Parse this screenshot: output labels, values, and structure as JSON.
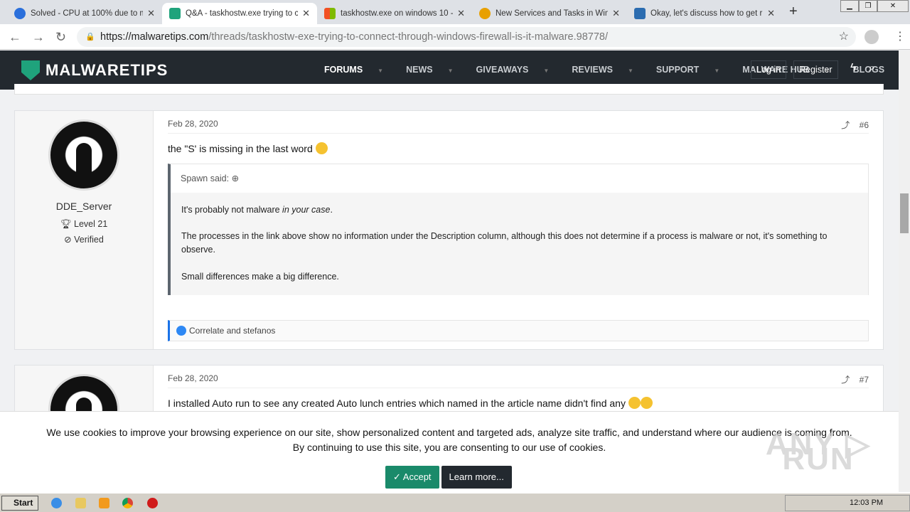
{
  "browser": {
    "tabs": [
      {
        "title": "Solved - CPU at 100% due to m",
        "color": "#2a6fdb",
        "active": false
      },
      {
        "title": "Q&A - taskhostw.exe trying to c",
        "color": "#1fa37c",
        "active": true
      },
      {
        "title": "taskhostw.exe on windows 10 -",
        "color": "#f25022",
        "active": false
      },
      {
        "title": "New Services and Tasks in Win",
        "color": "#e8a000",
        "active": false
      },
      {
        "title": "Okay, let's discuss how to get r",
        "color": "#2b6cb0",
        "active": false
      }
    ],
    "new_tab": "+",
    "url_domain": "https://malwaretips.com",
    "url_path": "/threads/taskhostw-exe-trying-to-connect-through-windows-firewall-is-it-malware.98778/"
  },
  "site": {
    "logo": "MALWARETIPS",
    "nav": [
      {
        "label": "FORUMS",
        "dropdown": true,
        "active": true
      },
      {
        "label": "NEWS",
        "dropdown": true
      },
      {
        "label": "GIVEAWAYS",
        "dropdown": true
      },
      {
        "label": "REVIEWS",
        "dropdown": true
      },
      {
        "label": "SUPPORT",
        "dropdown": true
      },
      {
        "label": "MALWARE HUB",
        "dropdown": true
      },
      {
        "label": "BLOGS",
        "dropdown": false
      }
    ],
    "login": "Log in",
    "register": "Register",
    "accent": "#1fa37c"
  },
  "posts": [
    {
      "user": "DDE_Server",
      "level": "Level 21",
      "verified": "Verified",
      "date": "Feb 28, 2020",
      "number": "#6",
      "text": "the \"S' is missing in the last word",
      "quote": {
        "author": "Spawn said:",
        "p1a": "It's probably not malware ",
        "p1b": "in your case",
        "p1c": ".",
        "p2": "The processes in the link above show no information under the Description column, although this does not determine if a process is malware or not, it's something to observe.",
        "p3": "Small differences make a big difference."
      },
      "reactions": "Correlate and stefanos"
    },
    {
      "date": "Feb 28, 2020",
      "number": "#7",
      "text": "I installed Auto run to see any created Auto lunch entries which named in the article name didn't find any"
    }
  ],
  "cookie": {
    "line1": "We use cookies to improve your browsing experience on our site, show personalized content and targeted ads, analyze site traffic, and understand where our audience is coming from.",
    "line2": "By continuing to use this site, you are consenting to our use of cookies.",
    "accept": "✓ Accept",
    "learn": "Learn more..."
  },
  "watermark": "ANY RUN",
  "taskbar": {
    "start": "Start",
    "clock": "12:03 PM"
  }
}
